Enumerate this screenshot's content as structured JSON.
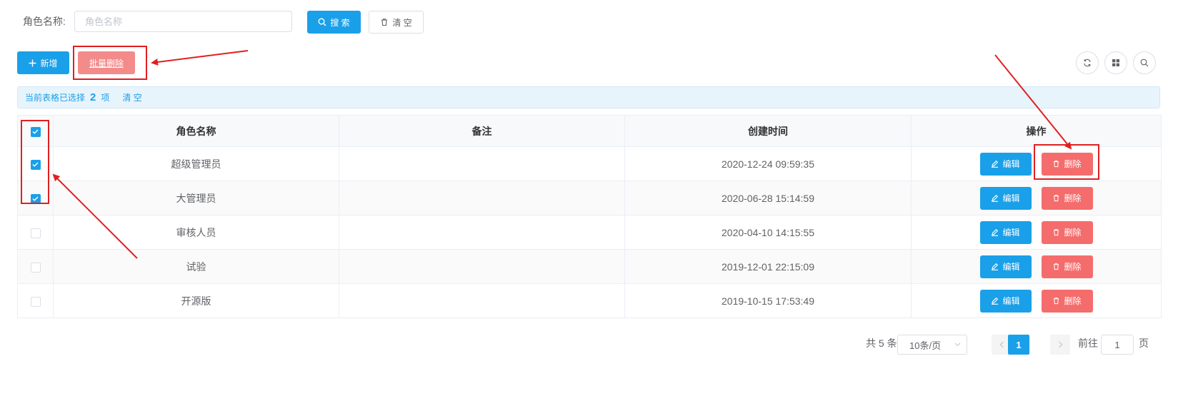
{
  "search": {
    "label": "角色名称:",
    "placeholder": "角色名称",
    "value": "",
    "search_label": "搜 索",
    "reset_label": "清 空"
  },
  "toolbar": {
    "add_label": "新增",
    "batch_delete_label": "批量删除"
  },
  "selection": {
    "prefix": "当前表格已选择",
    "count": "2",
    "suffix": "项",
    "clear_label": "清 空"
  },
  "table": {
    "columns": [
      "角色名称",
      "备注",
      "创建时间",
      "操作"
    ],
    "rows": [
      {
        "name": "超级管理员",
        "remark": "",
        "created": "2020-12-24 09:59:35",
        "checked": true
      },
      {
        "name": "大管理员",
        "remark": "",
        "created": "2020-06-28 15:14:59",
        "checked": true
      },
      {
        "name": "审核人员",
        "remark": "",
        "created": "2020-04-10 14:15:55",
        "checked": false
      },
      {
        "name": "试验",
        "remark": "",
        "created": "2019-12-01 22:15:09",
        "checked": false
      },
      {
        "name": "开源版",
        "remark": "",
        "created": "2019-10-15 17:53:49",
        "checked": false
      }
    ],
    "edit_label": "编辑",
    "delete_label": "删除"
  },
  "pagination": {
    "total_label": "共 5 条",
    "page_size_label": "10条/页",
    "current_page": "1",
    "goto_prefix": "前往",
    "goto_value": "1",
    "goto_suffix": "页"
  },
  "colors": {
    "primary": "#1aa0e8",
    "danger": "#f56c6c",
    "annotation_red": "#e02020"
  },
  "icons": [
    "search-icon",
    "trash-icon",
    "plus-icon",
    "refresh-icon",
    "grid-icon",
    "search-circle-icon",
    "edit-icon",
    "chevron-down-icon",
    "chevron-left-icon",
    "chevron-right-icon",
    "check-icon"
  ]
}
